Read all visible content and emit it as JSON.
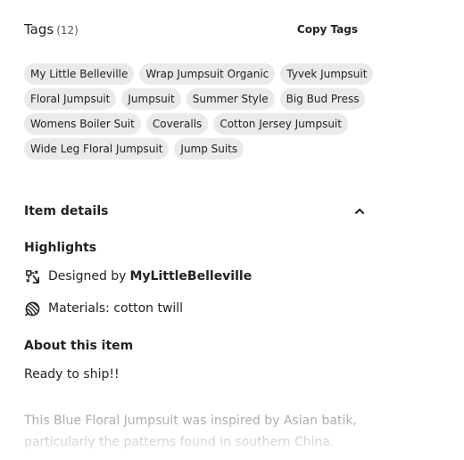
{
  "tags": {
    "title": "Tags",
    "count": "(12)",
    "copy_label": "Copy Tags",
    "items": [
      "My Little Belleville",
      "Wrap Jumpsuit Organic",
      "Tyvek Jumpsuit",
      "Floral Jumpsuit",
      "Jumpsuit",
      "Summer Style",
      "Big Bud Press",
      "Womens Boiler Suit",
      "Coveralls",
      "Cotton Jersey Jumpsuit",
      "Wide Leg Floral Jumpsuit",
      "Jump Suits"
    ]
  },
  "item_details": {
    "title": "Item details",
    "toggle_icon": "chevron-up-icon",
    "highlights_title": "Highlights",
    "designed_by_label": "Designed by",
    "designer_name": "MyLittleBelleville",
    "designer_icon": "hand-made-icon",
    "materials_text": "Materials: cotton twill",
    "materials_icon": "yarn-ball-icon",
    "about_title": "About this item",
    "ready_text": "Ready to ship!!",
    "description": "This Blue Floral Jumpsuit was inspired by Asian batik, particularly the patterns found in southern China."
  },
  "colors": {
    "tag_bg": "#eaeaea",
    "text": "#222222",
    "muted": "#595959"
  }
}
